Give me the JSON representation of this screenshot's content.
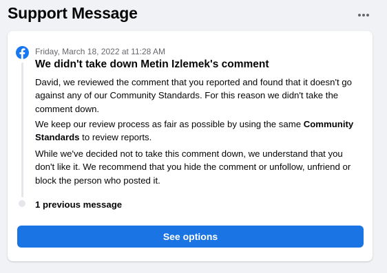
{
  "page": {
    "title": "Support Message",
    "more_icon": "more-horizontal-icon"
  },
  "message": {
    "icon": "facebook-logo-icon",
    "brand_color": "#1877f2",
    "timestamp": "Friday, March 18, 2022 at 11:28 AM",
    "headline": "We didn't take down Metin Izlemek's comment",
    "paragraph1": "David, we reviewed the comment that you reported and found that it doesn't go against any of our Community Standards. For this reason we didn't take the comment down.",
    "paragraph2_before": "We keep our review process as fair as possible by using the same ",
    "paragraph2_bold": "Community Standards",
    "paragraph2_after": " to review reports.",
    "paragraph3": "While we've decided not to take this comment down, we understand that you don't like it. We recommend that you hide the comment or unfollow, unfriend or block the person who posted it.",
    "previous_messages": "1 previous message"
  },
  "actions": {
    "see_options_label": "See options",
    "button_color": "#1b74e4"
  }
}
